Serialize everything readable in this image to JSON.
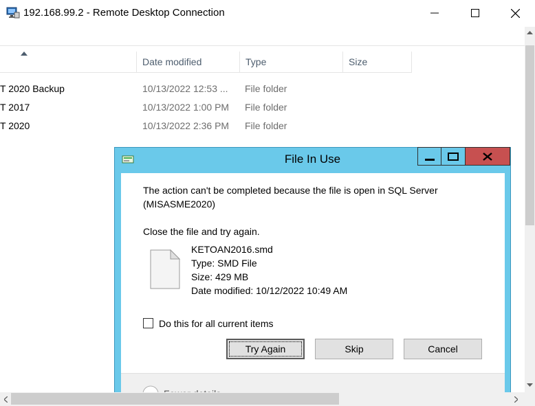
{
  "rdp": {
    "title": "192.168.99.2 - Remote Desktop Connection",
    "icon": "remote-desktop-icon",
    "controls": {
      "minimize": "minimize-icon",
      "maximize": "maximize-icon",
      "close": "close-icon"
    }
  },
  "explorer": {
    "columns": [
      "Date modified",
      "Type",
      "Size"
    ],
    "rows": [
      {
        "name": "T 2020 Backup",
        "date": "10/13/2022 12:53 ...",
        "type": "File folder"
      },
      {
        "name": "T 2017",
        "date": "10/13/2022 1:00 PM",
        "type": "File folder"
      },
      {
        "name": "T 2020",
        "date": "10/13/2022 2:36 PM",
        "type": "File folder"
      }
    ]
  },
  "dialog": {
    "title": "File In Use",
    "message_line1": "The action can't be completed because the file is open in SQL Server",
    "message_line2": "(MISASME2020)",
    "instruction": "Close the file and try again.",
    "file": {
      "name": "KETOAN2016.smd",
      "type": "Type: SMD File",
      "size": "Size: 429 MB",
      "date_modified": "Date modified: 10/12/2022 10:49 AM",
      "icon": "file-icon"
    },
    "checkbox_label": "Do this for all current items",
    "checkbox_checked": false,
    "buttons": {
      "try_again": "Try Again",
      "skip": "Skip",
      "cancel": "Cancel"
    },
    "more_details": "Fewer details"
  },
  "colors": {
    "dialog_frame": "#6ac9ea",
    "close_button": "#c75050"
  }
}
